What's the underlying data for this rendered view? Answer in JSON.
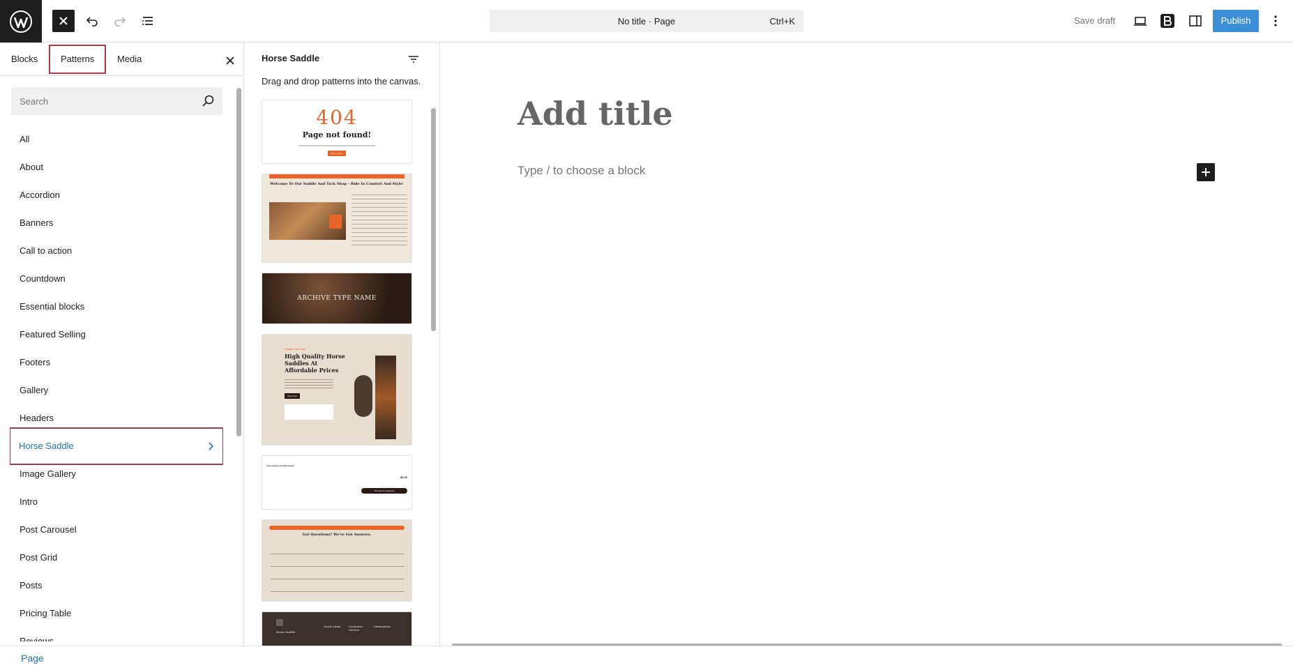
{
  "topbar": {
    "logo_icon": "wordpress-logo",
    "command_bar_text": "No title · Page",
    "command_shortcut": "Ctrl+K",
    "save_draft": "Save draft",
    "publish": "Publish"
  },
  "sidebar": {
    "tabs": [
      "Blocks",
      "Patterns",
      "Media"
    ],
    "active_tab": "Patterns",
    "search_placeholder": "Search",
    "categories": [
      "All",
      "About",
      "Accordion",
      "Banners",
      "Call to action",
      "Countdown",
      "Essential blocks",
      "Featured Selling",
      "Footers",
      "Gallery",
      "Headers",
      "Horse Saddle",
      "Image Gallery",
      "Intro",
      "Post Carousel",
      "Post Grid",
      "Posts",
      "Pricing Table",
      "Reviews"
    ],
    "selected_category": "Horse Saddle"
  },
  "patterns_panel": {
    "title": "Horse Saddle",
    "hint": "Drag and drop patterns into the canvas.",
    "cards": {
      "not_found_code": "404",
      "not_found_title": "Page not found!",
      "not_found_button": "Go to Home",
      "welcome_heading": "Welcome To Our Saddle And Tack Shop – Ride In Comfort And Style!",
      "archive_title": "ARCHIVE TYPE NAME",
      "hero_kicker": "Saddle Fair Pros",
      "hero_title_1": "High Quality Horse",
      "hero_title_2": "Saddles At",
      "hero_title_3": "Affordable Prices",
      "hero_button": "Shop Now",
      "cart_text": "Your cart is currently empty",
      "cart_price": "$0.00",
      "cart_button": "Proceed To Checkout",
      "faq_heading": "Got Questions? We've Got Answers.",
      "footer_brand": "Horse Saddle",
      "footer_col1": "Quick Links",
      "footer_col2": "Customer Service",
      "footer_col3": "Information"
    }
  },
  "canvas": {
    "title_placeholder": "Add title",
    "block_placeholder": "Type / to choose a block"
  },
  "footer": {
    "breadcrumb": "Page"
  },
  "colors": {
    "accent": "#2271b1",
    "highlight_outline": "#a63c4a",
    "publish_bg": "#3b8fd6",
    "pattern_orange": "#e8652a"
  }
}
